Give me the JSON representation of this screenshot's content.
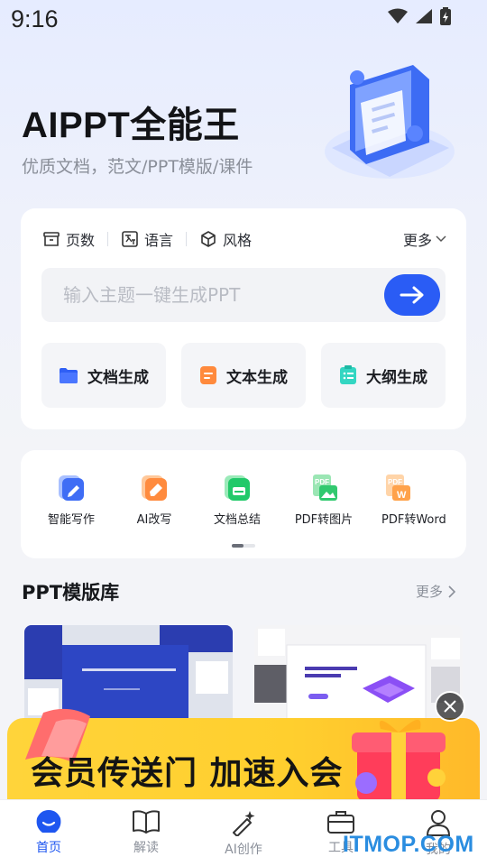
{
  "status_bar": {
    "time": "9:16"
  },
  "header": {
    "title": "AIPPT全能王",
    "subtitle": "优质文档，范文/PPT模版/课件"
  },
  "options": {
    "pages": "页数",
    "language": "语言",
    "style": "风格",
    "more": "更多"
  },
  "search": {
    "placeholder": "输入主题一键生成PPT"
  },
  "generate": {
    "doc": "文档生成",
    "text": "文本生成",
    "outline": "大纲生成"
  },
  "tools": [
    {
      "label": "智能写作",
      "icon": "pen-doc-icon"
    },
    {
      "label": "AI改写",
      "icon": "eraser-doc-icon"
    },
    {
      "label": "文档总结",
      "icon": "summary-doc-icon"
    },
    {
      "label": "PDF转图片",
      "icon": "pdf-image-icon"
    },
    {
      "label": "PDF转Word",
      "icon": "pdf-word-icon"
    }
  ],
  "library": {
    "title": "PPT模版库",
    "more": "更多"
  },
  "promo": {
    "text": "会员传送门 加速入会"
  },
  "nav": [
    {
      "label": "首页",
      "active": true
    },
    {
      "label": "解读",
      "active": false
    },
    {
      "label": "AI创作",
      "active": false
    },
    {
      "label": "工具",
      "active": false
    },
    {
      "label": "我的",
      "active": false
    }
  ],
  "watermark": "ITMOP.COM",
  "colors": {
    "accent": "#2a5cf5",
    "promo": "#ffd43a"
  }
}
